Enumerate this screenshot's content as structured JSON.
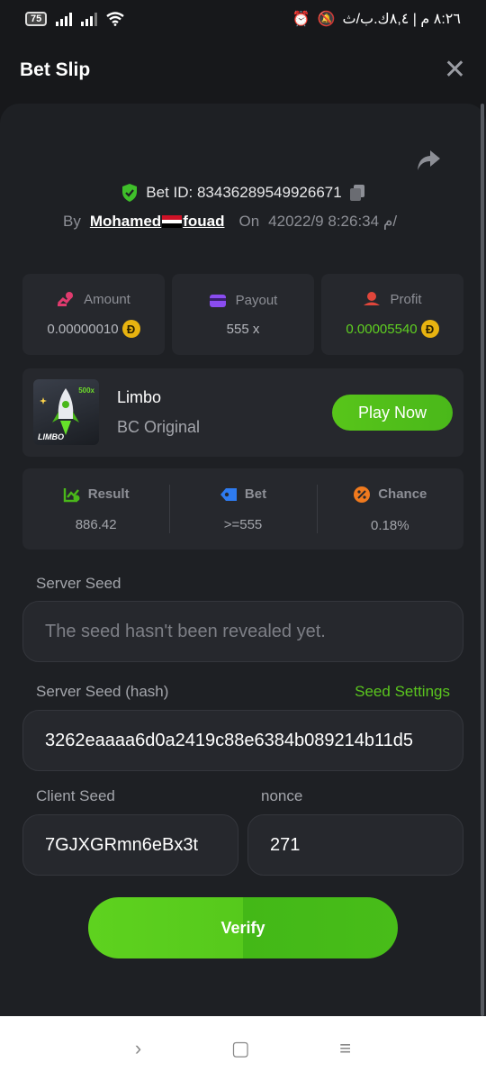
{
  "status_bar": {
    "battery": "75",
    "right_text": "٨:٢٦ م | ٨,٤ك.ب/ث"
  },
  "header": {
    "title": "Bet Slip",
    "close_icon": "close-icon"
  },
  "bet": {
    "id_text": "Bet ID: 83436289549926671",
    "by_label": "By",
    "username_part1": "Mohamed",
    "username_part2": "fouad",
    "on_label": "On",
    "datetime": "4م 8:26:34 2022/9/"
  },
  "stats": [
    {
      "label": "Amount",
      "value": "0.00000010",
      "icon": "amount-icon",
      "coin": "Ð"
    },
    {
      "label": "Payout",
      "value": "555 x",
      "icon": "payout-icon"
    },
    {
      "label": "Profit",
      "value": "0.00005540",
      "icon": "profit-icon",
      "coin": "Ð"
    }
  ],
  "game": {
    "name": "Limbo",
    "subtitle": "BC Original",
    "thumb_tag": "LIMBO",
    "thumb_multiplier": "500x",
    "play_label": "Play Now"
  },
  "result": [
    {
      "label": "Result",
      "value": "886.42"
    },
    {
      "label": "Bet",
      "value": ">=555"
    },
    {
      "label": "Chance",
      "value": "0.18%"
    }
  ],
  "seeds": {
    "server_seed_label": "Server Seed",
    "server_seed_placeholder": "The seed hasn't been revealed yet.",
    "server_hash_label": "Server Seed (hash)",
    "seed_settings": "Seed Settings",
    "server_hash_value": "3262eaaaa6d0a2419c88e6384b089214b11d5",
    "client_seed_label": "Client Seed",
    "client_seed_value": "7GJXGRmn6eBx3t",
    "nonce_label": "nonce",
    "nonce_value": "271"
  },
  "verify_label": "Verify",
  "nav": {
    "back": "›",
    "home": "▢",
    "menu": "≡"
  },
  "colors": {
    "accent_green": "#5fd021",
    "bg": "#17181b",
    "card": "#26282d"
  }
}
